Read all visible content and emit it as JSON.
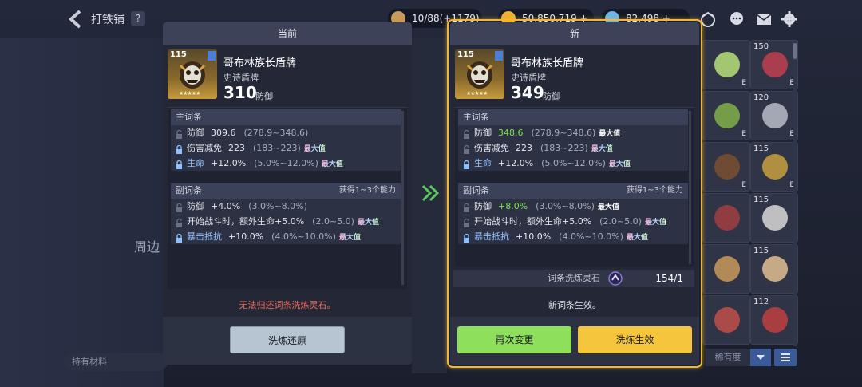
{
  "top": {
    "title": "打铁铺",
    "help": "?",
    "resources": [
      {
        "name": "hammer-resource",
        "text": "10/88(+1179)",
        "color": "#c89a5a"
      },
      {
        "name": "gold-resource",
        "text": "50,850,719 +",
        "color": "#f0b030"
      },
      {
        "name": "gem-resource",
        "text": "82,498 +",
        "color": "#6ab4f0"
      }
    ]
  },
  "left_bg": {
    "side_text": "周边",
    "hold_material": "持有材料"
  },
  "grid": {
    "cells": [
      {
        "lvl": "",
        "e": "E",
        "color": "#b7e07a"
      },
      {
        "lvl": "150",
        "e": "E",
        "color": "#c04050"
      },
      {
        "lvl": "",
        "e": "E",
        "color": "#7fb04a"
      },
      {
        "lvl": "120",
        "e": "E",
        "color": "#b8bcc8"
      },
      {
        "lvl": "",
        "e": "E",
        "color": "#7a5030"
      },
      {
        "lvl": "115",
        "e": "E",
        "color": "#c8a040"
      },
      {
        "lvl": "",
        "e": "",
        "color": "#a04040"
      },
      {
        "lvl": "115",
        "e": "",
        "color": "#d8d8d8"
      },
      {
        "lvl": "",
        "e": "",
        "color": "#c89a5a"
      },
      {
        "lvl": "115",
        "e": "",
        "color": "#e0c090"
      },
      {
        "lvl": "",
        "e": "",
        "color": "#c0504a"
      },
      {
        "lvl": "112",
        "e": "",
        "color": "#c04040"
      }
    ],
    "sort_label": "稀有度"
  },
  "current": {
    "header": "当前",
    "item": {
      "level": "115",
      "name": "哥布林族长盾牌",
      "type": "史诗盾牌",
      "value": "310",
      "unit": "防御"
    },
    "main_title": "主词条",
    "main_stats": [
      {
        "name": "防御",
        "value": "309.6",
        "range": "(278.9~348.6)",
        "max": "",
        "locked": false
      },
      {
        "name": "伤害减免",
        "value": "223",
        "range": "(183~223)",
        "max": "最大值",
        "locked": true
      },
      {
        "name": "生命",
        "value": "+12.0%",
        "range": "(5.0%~12.0%)",
        "max": "最大值",
        "locked": true
      }
    ],
    "sub_title": "副词条",
    "sub_hint": "获得1~3个能力",
    "sub_stats": [
      {
        "name": "防御",
        "value": "+4.0%",
        "range": "(3.0%~8.0%)",
        "max": "",
        "locked": false
      },
      {
        "name": "开始战斗时，额外生命+5.0%",
        "value": "",
        "range": "(2.0~5.0)",
        "max": "最大值",
        "locked": false
      },
      {
        "name": "暴击抵抗",
        "value": "+10.0%",
        "range": "(4.0%~10.0%)",
        "max": "最大值",
        "locked": true
      }
    ],
    "note": "无法归还词条洗炼灵石。",
    "button": "洗炼还原"
  },
  "new": {
    "header": "新",
    "item": {
      "level": "115",
      "name": "哥布林族长盾牌",
      "type": "史诗盾牌",
      "value": "349",
      "unit": "防御"
    },
    "main_title": "主词条",
    "main_stats": [
      {
        "name": "防御",
        "value": "348.6",
        "range": "(278.9~348.6)",
        "max": "最大值",
        "locked": false
      },
      {
        "name": "伤害减免",
        "value": "223",
        "range": "(183~223)",
        "max": "最大值",
        "locked": false
      },
      {
        "name": "生命",
        "value": "+12.0%",
        "range": "(5.0%~12.0%)",
        "max": "最大值",
        "locked": true
      }
    ],
    "sub_title": "副词条",
    "sub_hint": "获得1~3个能力",
    "sub_stats": [
      {
        "name": "防御",
        "value": "+8.0%",
        "range": "(3.0%~8.0%)",
        "max": "最大值",
        "locked": false
      },
      {
        "name": "开始战斗时，额外生命+5.0%",
        "value": "",
        "range": "(2.0~5.0)",
        "max": "最大值",
        "locked": false
      },
      {
        "name": "暴击抵抗",
        "value": "+10.0%",
        "range": "(4.0%~10.0%)",
        "max": "最大值",
        "locked": true
      }
    ],
    "stone_label": "词条洗炼灵石",
    "stone_count": "154/1",
    "note": "新词条生效。",
    "button_again": "再次变更",
    "button_apply": "洗炼生效"
  }
}
